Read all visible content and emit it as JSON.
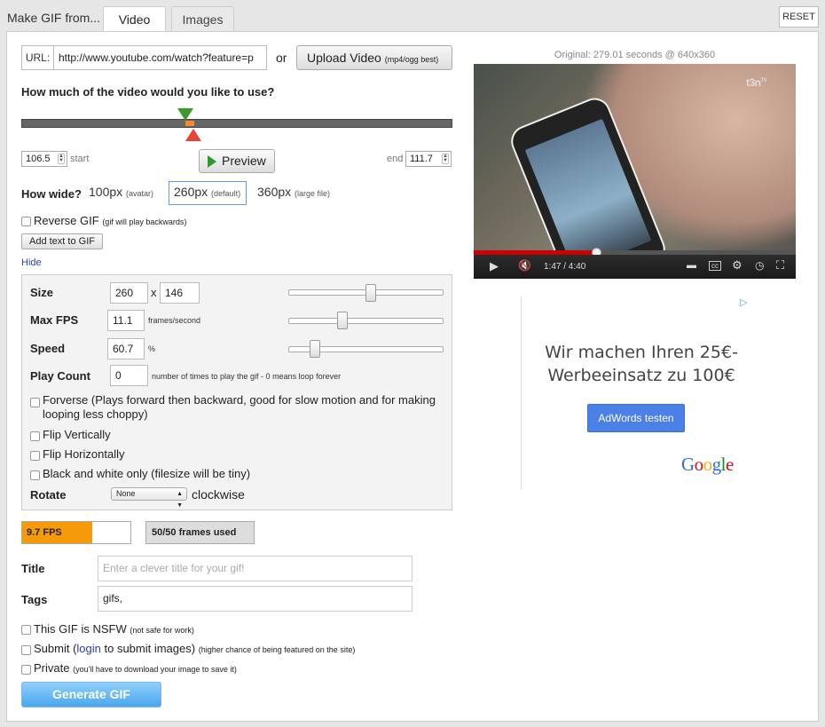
{
  "app": {
    "title": "Make GIF from...",
    "reset_label": "RESET"
  },
  "tabs": [
    {
      "label": "Video",
      "active": true
    },
    {
      "label": "Images",
      "active": false
    }
  ],
  "source": {
    "url_label": "URL:",
    "url_value": "http://www.youtube.com/watch?feature=p",
    "or_label": "or",
    "upload_label": "Upload Video",
    "upload_note": "(mp4/ogg best)"
  },
  "range": {
    "question": "How much of the video would you like to use?",
    "start_value": "106.5",
    "start_label": "start",
    "end_label": "end",
    "end_value": "111.7",
    "preview_label": "Preview"
  },
  "width": {
    "question": "How wide?",
    "options": [
      {
        "label": "100px",
        "note": "(avatar)"
      },
      {
        "label": "260px",
        "note": "(default)",
        "selected": true
      },
      {
        "label": "360px",
        "note": "(large file)"
      }
    ]
  },
  "reverse": {
    "label": "Reverse GIF",
    "note": "(gif will play backwards)",
    "checked": false
  },
  "add_text_label": "Add text to GIF",
  "hide_label": "Hide",
  "options": {
    "size_label": "Size",
    "size_w": "260",
    "size_x": "x",
    "size_h": "146",
    "fps_label": "Max FPS",
    "fps_value": "11.1",
    "fps_unit": "frames/second",
    "speed_label": "Speed",
    "speed_value": "60.7",
    "speed_unit": "%",
    "playcount_label": "Play Count",
    "playcount_value": "0",
    "playcount_note": "number of times to play the gif - 0 means loop forever",
    "forverse_label": "Forverse (Plays forward then backward, good for slow motion and for making looping less choppy)",
    "flip_v_label": "Flip Vertically",
    "flip_h_label": "Flip Horizontally",
    "bw_label": "Black and white only (filesize will be tiny)",
    "rotate_label": "Rotate",
    "rotate_value": "None",
    "rotate_suffix": "clockwise",
    "slider_size_level": 0.53,
    "slider_fps_level": 0.35,
    "slider_speed_level": 0.17
  },
  "stats": {
    "fps_label": "9.7 FPS",
    "fps_fill_fraction": 0.65,
    "frames_label": "50/50 frames used"
  },
  "meta": {
    "title_label": "Title",
    "title_placeholder": "Enter a clever title for your gif!",
    "tags_label": "Tags",
    "tags_value": "gifs,"
  },
  "flags": {
    "nsfw_label": "This GIF is NSFW",
    "nsfw_note": "(not safe for work)",
    "submit_label_pre": "Submit (",
    "submit_link": "login",
    "submit_label_post": " to submit images)",
    "submit_note": "(higher chance of being featured on the site)",
    "private_label": "Private",
    "private_note": "(you'll have to download your image to save it)"
  },
  "generate_label": "Generate GIF",
  "video": {
    "original_info": "Original: 279.01 seconds @ 640x360",
    "watermark": "t3n",
    "watermark_sup": "TV",
    "time": "1:47 / 4:40",
    "progress_fraction": 0.38
  },
  "ad": {
    "text": "Wir machen Ihren 25€-Werbeeinsatz zu 100€",
    "button_label": "AdWords testen",
    "brand": "Google",
    "brand_colors": [
      "#3369e8",
      "#d50f25",
      "#eeb211",
      "#3369e8",
      "#009925",
      "#d50f25"
    ]
  }
}
